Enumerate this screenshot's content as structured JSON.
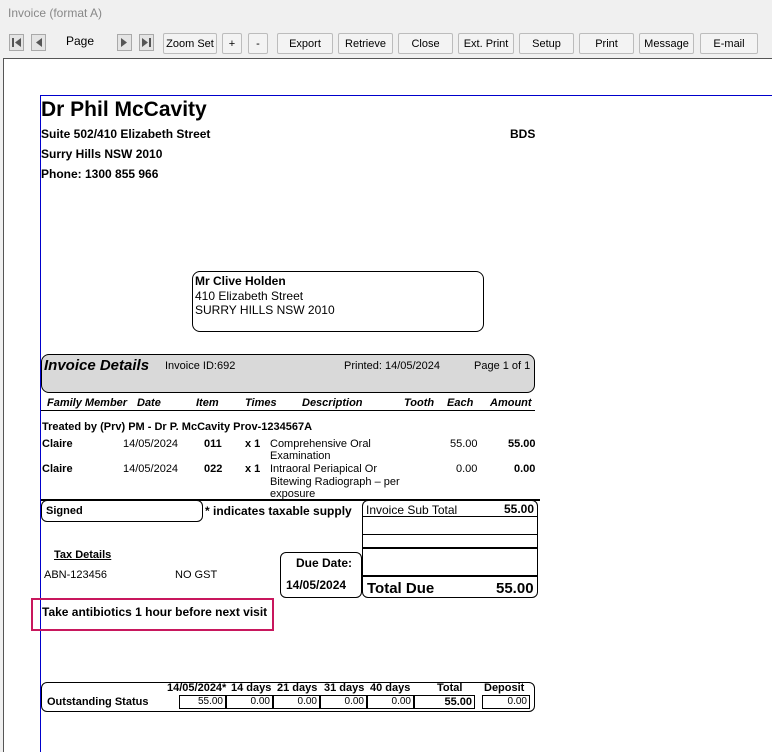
{
  "window": {
    "title": "Invoice (format A)"
  },
  "toolbar": {
    "page_label": "Page",
    "buttons": [
      {
        "key": "zoom_set",
        "label": "Zoom Set"
      },
      {
        "key": "zoom_in",
        "label": "+"
      },
      {
        "key": "zoom_out",
        "label": "-"
      },
      {
        "key": "export",
        "label": "Export"
      },
      {
        "key": "retrieve",
        "label": "Retrieve"
      },
      {
        "key": "close",
        "label": "Close"
      },
      {
        "key": "ext_print",
        "label": "Ext. Print"
      },
      {
        "key": "setup",
        "label": "Setup"
      },
      {
        "key": "print",
        "label": "Print"
      },
      {
        "key": "message",
        "label": "Message"
      },
      {
        "key": "email",
        "label": "E-mail"
      }
    ]
  },
  "practice": {
    "name": "Dr Phil McCavity",
    "address1": "Suite 502/410 Elizabeth Street",
    "address2": "Surry Hills NSW 2010",
    "phone": "Phone: 1300 855 966",
    "qualification": "BDS"
  },
  "patient": {
    "name": "Mr Clive  Holden",
    "address1": "410 Elizabeth Street",
    "address2": "SURRY HILLS NSW 2010"
  },
  "invoice": {
    "heading": "Invoice Details",
    "id": "Invoice ID:692",
    "printed": "Printed: 14/05/2024",
    "page": "Page 1 of 1"
  },
  "table": {
    "headers": {
      "family_member": "Family Member",
      "date": "Date",
      "item": "Item",
      "times": "Times",
      "description": "Description",
      "tooth": "Tooth",
      "each": "Each",
      "amount": "Amount"
    },
    "treated_by": "Treated by (Prv) PM - Dr P. McCavity Prov-1234567A",
    "rows": [
      {
        "member": "Claire",
        "date": "14/05/2024",
        "item": "011",
        "times": "x 1",
        "description": "Comprehensive Oral Examination",
        "each": "55.00",
        "amount": "55.00"
      },
      {
        "member": "Claire",
        "date": "14/05/2024",
        "item": "022",
        "times": "x 1",
        "description": "Intraoral Periapical Or Bitewing Radiograph – per exposure",
        "each": "0.00",
        "amount": "0.00"
      }
    ]
  },
  "footer": {
    "signed": "Signed",
    "taxable_note": "* indicates taxable supply",
    "sub_total_label": "Invoice Sub Total",
    "sub_total_value": "55.00",
    "tax_details_label": "Tax Details",
    "abn": "ABN-123456",
    "gst": "NO GST",
    "due_date_label": "Due Date:",
    "due_date": "14/05/2024",
    "total_due_label": "Total Due",
    "total_due_value": "55.00",
    "note": "Take antibiotics 1 hour before next visit"
  },
  "outstanding": {
    "label": "Outstanding Status",
    "headers": [
      "14/05/2024*",
      "14 days",
      "21 days",
      "31 days",
      "40 days",
      "Total",
      "Deposit"
    ],
    "values": [
      "55.00",
      "0.00",
      "0.00",
      "0.00",
      "0.00",
      "55.00",
      "0.00"
    ]
  }
}
